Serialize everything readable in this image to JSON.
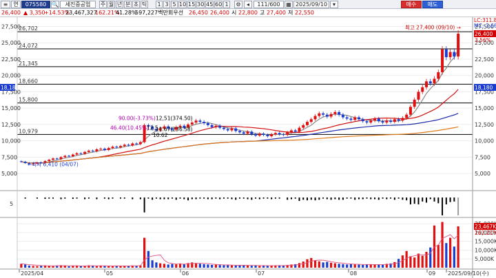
{
  "toolbar": {
    "menu_icon": "list-icon",
    "view_label": "연",
    "code": "075580",
    "name": "세진중공업",
    "periods": [
      "주",
      "월",
      "년",
      "분",
      "초",
      "틱"
    ],
    "intervals": [
      "1",
      "3",
      "5",
      "10",
      "15",
      "30",
      "45",
      "60",
      "1"
    ],
    "count": "111/600",
    "date": "2025/09/10",
    "buy_label": "매수",
    "sell_label": "매도"
  },
  "infobar": {
    "price": "26,400",
    "change": "▲ 3,350",
    "change_pct": "+14.53%",
    "volume": "23,467,327",
    "vol_ratio": "162.21%",
    "turnover": "41.28%",
    "amount": "597,227백만",
    "credit": "회우선",
    "o1": "26,450",
    "o2": "26,400",
    "high_label": "시",
    "high": "22,800",
    "low_label": "고",
    "low": "27,400",
    "low2_label": "저",
    "low2": "22,550"
  },
  "chart_data": {
    "type": "candlestick",
    "price_axis": {
      "ticks": [
        "27,500",
        "25,000",
        "22,500",
        "20,000",
        "17,500",
        "15,000",
        "12,500",
        "10,000",
        "7,500",
        "5,000"
      ],
      "range": [
        2800,
        28500
      ]
    },
    "x_labels": [
      "2025/04",
      "05",
      "06",
      "07",
      "08",
      "09",
      "2025/09/10(수)"
    ],
    "horizontal_levels": [
      {
        "label": "26,702",
        "value": 26702
      },
      {
        "label": "24,072",
        "value": 24072
      },
      {
        "label": "21,345",
        "value": 21345
      },
      {
        "label": "18,660",
        "value": 18660
      },
      {
        "label": "15,800",
        "value": 15800
      },
      {
        "label": "10,979",
        "value": 10979
      }
    ],
    "right_tags": {
      "current": "26,400",
      "current_pct": "3.56%",
      "lc": "LC:311.86",
      "mc": "MC:-3.66",
      "level1": "18,180",
      "level1_left": "18,180"
    },
    "annotations": {
      "high": "최고 27,400 (09/10) →",
      "low": "←최저 6,410 (04/07)",
      "a1": "90.00(-3.73%)",
      "a2": "12,51(374.50)",
      "a3": "46.40(10.45%)",
      "a4": "12,5",
      "a5": "11.67(236.58)",
      "a6": "10.62"
    },
    "closes": [
      6800,
      6600,
      6450,
      6500,
      6700,
      6650,
      6900,
      7100,
      7300,
      7200,
      7500,
      7700,
      7650,
      7900,
      8100,
      8000,
      8300,
      8500,
      8400,
      8700,
      8800,
      8600,
      8900,
      9100,
      9000,
      9200,
      9400,
      9300,
      9600,
      9500,
      9800,
      12400,
      12200,
      11800,
      11600,
      11900,
      12200,
      11900,
      11700,
      12100,
      12300,
      12000,
      12500,
      12800,
      13100,
      12900,
      12700,
      12400,
      12100,
      12300,
      12000,
      11800,
      11600,
      11900,
      11500,
      11300,
      11100,
      11400,
      11000,
      10800,
      11100,
      10900,
      10700,
      11000,
      11200,
      11000,
      10900,
      11300,
      11600,
      11400,
      12000,
      12400,
      12900,
      13300,
      13800,
      14200,
      14000,
      13700,
      14100,
      14400,
      14000,
      13600,
      13400,
      13200,
      13600,
      13300,
      13000,
      12800,
      13100,
      13400,
      13000,
      12800,
      13100,
      12900,
      13300,
      13100,
      13500,
      14000,
      15200,
      16300,
      17500,
      18200,
      19100,
      18800,
      19500,
      20500,
      24000,
      22800,
      23600,
      22900,
      26400
    ],
    "volume_axis": {
      "ticks": [
        "25,000K",
        "20,000K",
        "15,000K",
        "10,000K",
        "5,000K"
      ],
      "current": "23,467K",
      "current_pct": "162.21%"
    },
    "volumes": [
      2.2,
      1.8,
      1.2,
      1.0,
      0.9,
      1.1,
      1.3,
      1.0,
      0.9,
      1.2,
      1.4,
      1.1,
      0.8,
      1.0,
      1.2,
      0.9,
      1.1,
      1.3,
      1.0,
      0.9,
      1.1,
      1.0,
      0.8,
      0.9,
      1.2,
      1.0,
      1.1,
      0.9,
      1.2,
      1.1,
      1.3,
      17.0,
      9.5,
      4.2,
      3.0,
      2.5,
      2.2,
      1.8,
      2.1,
      1.9,
      2.4,
      2.0,
      2.6,
      3.0,
      2.5,
      2.2,
      2.0,
      1.8,
      1.6,
      1.7,
      1.5,
      1.4,
      1.6,
      1.3,
      1.2,
      1.4,
      1.5,
      1.2,
      1.1,
      1.3,
      1.0,
      1.2,
      1.1,
      1.0,
      1.3,
      1.4,
      1.2,
      1.5,
      1.8,
      2.0,
      2.6,
      3.5,
      4.8,
      5.5,
      4.2,
      3.6,
      3.0,
      3.3,
      2.8,
      2.5,
      2.2,
      2.0,
      1.8,
      2.1,
      1.9,
      1.7,
      1.6,
      1.8,
      2.0,
      1.9,
      1.7,
      1.6,
      2.2,
      2.4,
      3.2,
      5.0,
      7.0,
      9.5,
      6.5,
      5.8,
      8.0,
      6.8,
      9.0,
      11.5,
      24.0,
      13.0,
      26.0,
      14.0,
      17.0,
      12.0,
      23.5
    ],
    "macd_axis": {
      "tick": "5"
    }
  }
}
